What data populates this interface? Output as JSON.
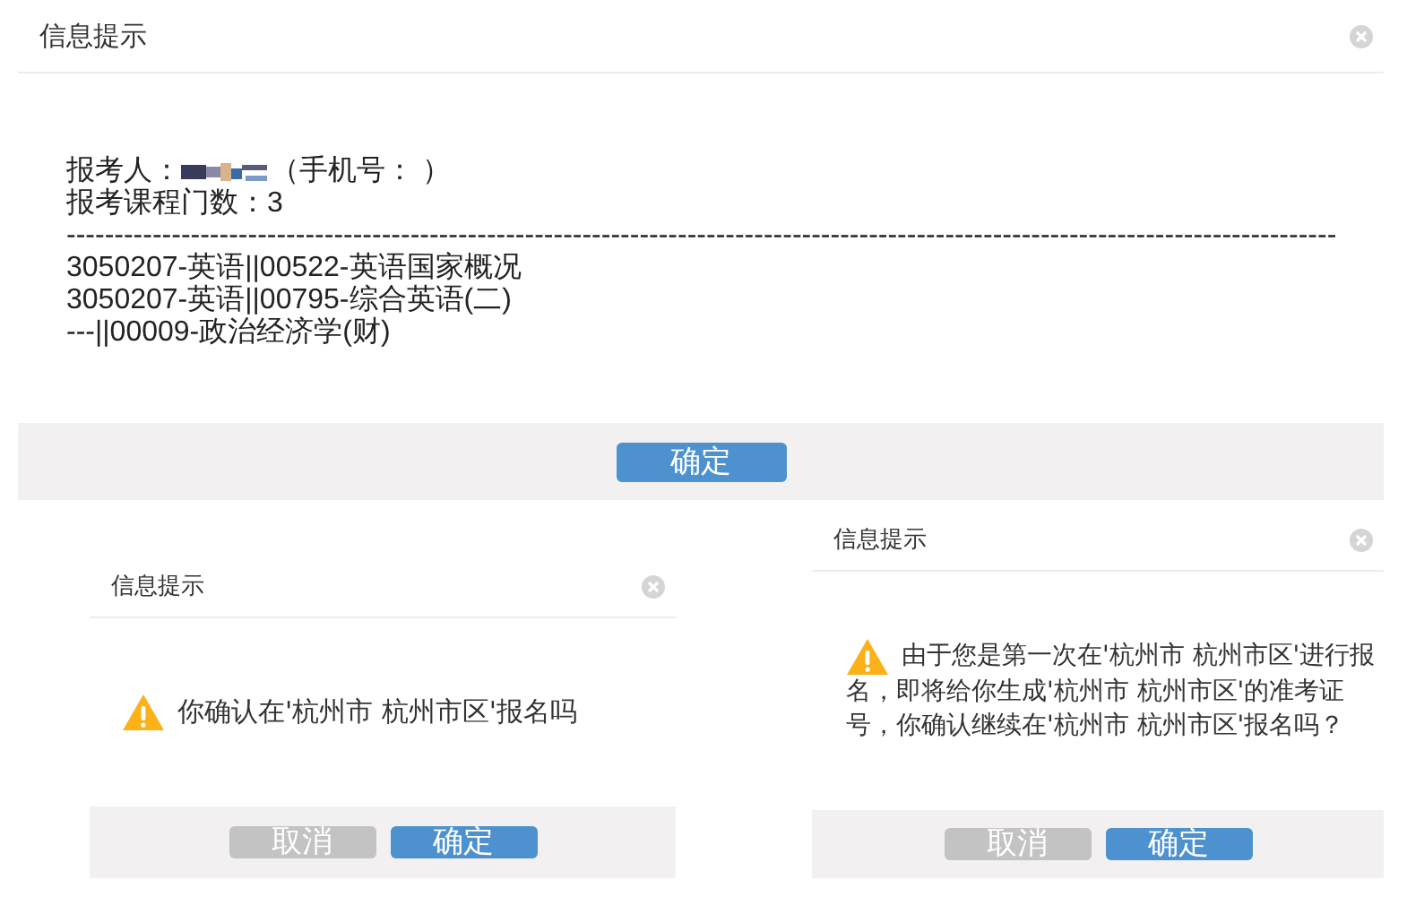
{
  "main_dialog": {
    "title": "信息提示",
    "applicant_label": "报考人：",
    "applicant_name": {
      "kind": "redacted"
    },
    "phone_label": "（手机号： ）",
    "course_count": "报考课程门数：3",
    "divider": "-------------------------------------------------------------------------------------------------------------------------------------",
    "courses": [
      "3050207-英语||00522-英语国家概况",
      "3050207-英语||00795-综合英语(二)",
      "---||00009-政治经济学(财)"
    ],
    "buttons": [
      {
        "label": "确定",
        "kind": "primary"
      }
    ]
  },
  "confirm_dialogs": [
    {
      "title": "信息提示",
      "message_lines": [
        "你确认在'杭州市 杭州市区'报名吗"
      ],
      "buttons": [
        {
          "label": "取消",
          "kind": "secondary"
        },
        {
          "label": "确定",
          "kind": "primary"
        }
      ]
    },
    {
      "title": "信息提示",
      "message_lines": [
        "由于您是第一次在'杭州市 杭州市区'进行报",
        "名，即将给你生成'杭州市 杭州市区'的准考证",
        "号，你确认继续在'杭州市 杭州市区'报名吗？"
      ],
      "buttons": [
        {
          "label": "取消",
          "kind": "secondary"
        },
        {
          "label": "确定",
          "kind": "primary"
        }
      ]
    }
  ]
}
